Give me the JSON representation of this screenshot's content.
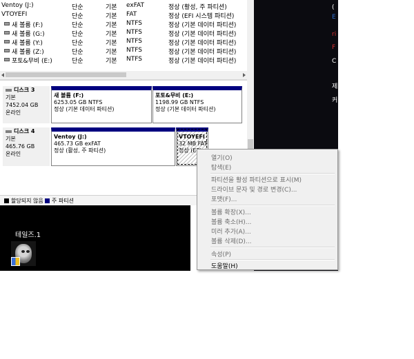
{
  "volumes": [
    {
      "name": "Ventoy (J:)",
      "layout": "단순",
      "type": "기본",
      "fs": "exFAT",
      "status": "정상 (활성, 주 파티션)"
    },
    {
      "name": "VTOYEFI",
      "layout": "단순",
      "type": "기본",
      "fs": "FAT",
      "status": "정상 (EFI 시스템 파티션)"
    },
    {
      "name": "새 볼륨 (F:)",
      "layout": "단순",
      "type": "기본",
      "fs": "NTFS",
      "status": "정상 (기본 데이터 파티션)"
    },
    {
      "name": "새 볼륨 (G:)",
      "layout": "단순",
      "type": "기본",
      "fs": "NTFS",
      "status": "정상 (기본 데이터 파티션)"
    },
    {
      "name": "새 볼륨 (Y:)",
      "layout": "단순",
      "type": "기본",
      "fs": "NTFS",
      "status": "정상 (기본 데이터 파티션)"
    },
    {
      "name": "새 볼륨 (Z:)",
      "layout": "단순",
      "type": "기본",
      "fs": "NTFS",
      "status": "정상 (기본 데이터 파티션)"
    },
    {
      "name": "포토&무비 (E:)",
      "layout": "단순",
      "type": "기본",
      "fs": "NTFS",
      "status": "정상 (기본 데이터 파티션)"
    }
  ],
  "disks": [
    {
      "name": "디스크 3",
      "type": "기본",
      "size": "7452.04 GB",
      "state": "온라인",
      "partitions": [
        {
          "name": "새 볼륨 (F:)",
          "size": "6253.05 GB NTFS",
          "status": "정상 (기본 데이터 파티션)"
        },
        {
          "name": "포토&무비 (E:)",
          "size": "1198.99 GB NTFS",
          "status": "정상 (기본 데이터 파티션)"
        }
      ]
    },
    {
      "name": "디스크 4",
      "type": "기본",
      "size": "465.76 GB",
      "state": "온라인",
      "partitions": [
        {
          "name": "Ventoy (J:)",
          "size": "465.73 GB exFAT",
          "status": "정상 (활성, 주 파티션)"
        },
        {
          "name": "VTOYEFI",
          "size": "32 MB FAT",
          "status": "정상 (EFI"
        }
      ]
    }
  ],
  "legend": {
    "unallocated": "할당되지 않음",
    "primary": "주 파티션"
  },
  "context_menu": [
    {
      "label": "열기(O)",
      "enabled": false
    },
    {
      "label": "탐색(E)",
      "enabled": false
    },
    {
      "label": "파티션을 활성 파티션으로 표시(M)",
      "enabled": false
    },
    {
      "label": "드라이브 문자 및 경로 변경(C)...",
      "enabled": false
    },
    {
      "label": "포맷(F)...",
      "enabled": false
    },
    {
      "label": "볼륨 확장(X)...",
      "enabled": false
    },
    {
      "label": "볼륨 축소(H)...",
      "enabled": false
    },
    {
      "label": "미러 추가(A)...",
      "enabled": false
    },
    {
      "label": "볼륨 삭제(D)...",
      "enabled": false
    },
    {
      "label": "속성(P)",
      "enabled": false
    },
    {
      "label": "도움말(H)",
      "enabled": true
    }
  ],
  "desktop": {
    "icon_label": "테일즈.1",
    "right_edge_fragments": [
      "(",
      "E",
      "ri",
      "F",
      "C",
      "제",
      "커"
    ]
  },
  "colors": {
    "primary_partition": "#00007f",
    "unallocated": "#000000",
    "desktop": "#000000"
  }
}
